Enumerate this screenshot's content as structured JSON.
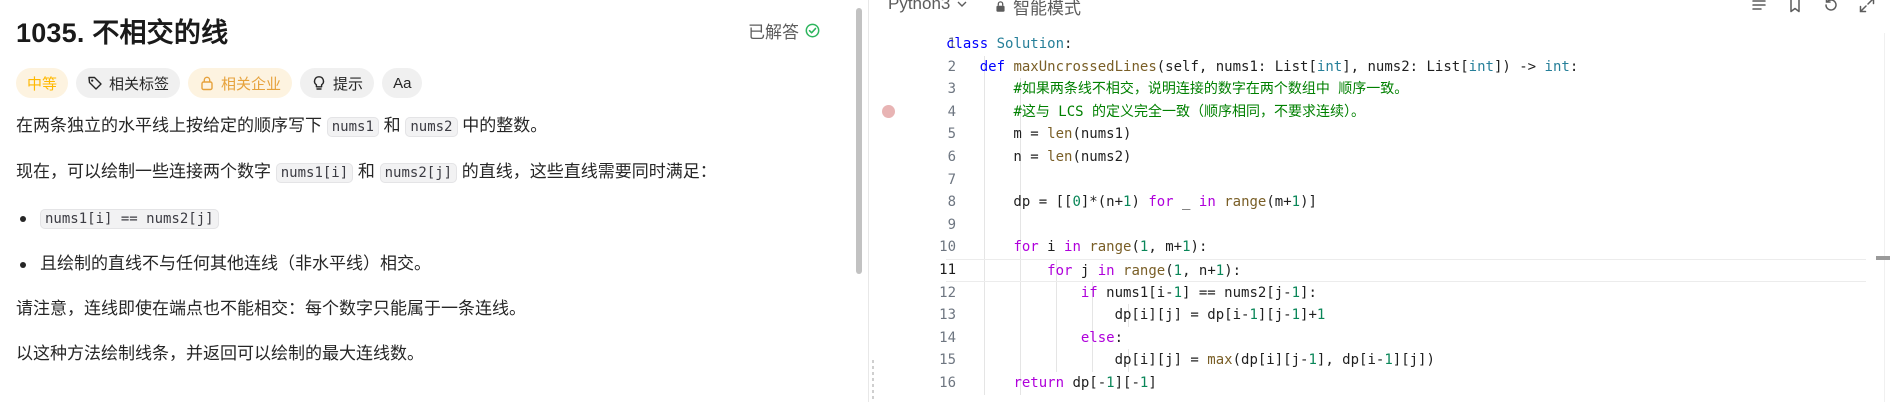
{
  "problem": {
    "title": "1035. 不相交的线",
    "solved_label": "已解答",
    "tags": {
      "difficulty": "中等",
      "related_tags": "相关标签",
      "related_companies": "相关企业",
      "hint": "提示",
      "font_toggle": "Aa"
    },
    "para1": {
      "a": "在两条独立的水平线上按给定的顺序写下 ",
      "code1": "nums1",
      "b": " 和 ",
      "code2": "nums2",
      "c": " 中的整数。"
    },
    "para2": {
      "a": "现在，可以绘制一些连接两个数字 ",
      "code1": "nums1[i]",
      "b": " 和 ",
      "code2": "nums2[j]",
      "c": " 的直线，这些直线需要同时满足："
    },
    "bullet1_code": "nums1[i] == nums2[j]",
    "bullet2": "且绘制的直线不与任何其他连线（非水平线）相交。",
    "para3": "请注意，连线即使在端点也不能相交：每个数字只能属于一条连线。",
    "para4": "以这种方法绘制线条，并返回可以绘制的最大连线数。"
  },
  "editor": {
    "language": "Python3",
    "mode": "智能模式",
    "active_line": 11,
    "breakpoint_line": 4,
    "line_numbers": [
      "1",
      "2",
      "3",
      "4",
      "5",
      "6",
      "7",
      "8",
      "9",
      "10",
      "11",
      "12",
      "13",
      "14",
      "15",
      "16"
    ]
  },
  "colors": {
    "accent_green": "#2db55d",
    "difficulty_yellow": "#ffb800",
    "keyword_blue": "#0000ff",
    "comment_green": "#008000"
  },
  "icons": {
    "solved": "check-circle-icon",
    "tags": "tag-icon",
    "company": "lock-icon",
    "hint": "lightbulb-icon",
    "language_dropdown": "chevron-down-icon",
    "mode": "lock-icon",
    "toolbar": [
      "list-icon",
      "bookmark-icon",
      "reset-icon",
      "expand-icon"
    ]
  }
}
